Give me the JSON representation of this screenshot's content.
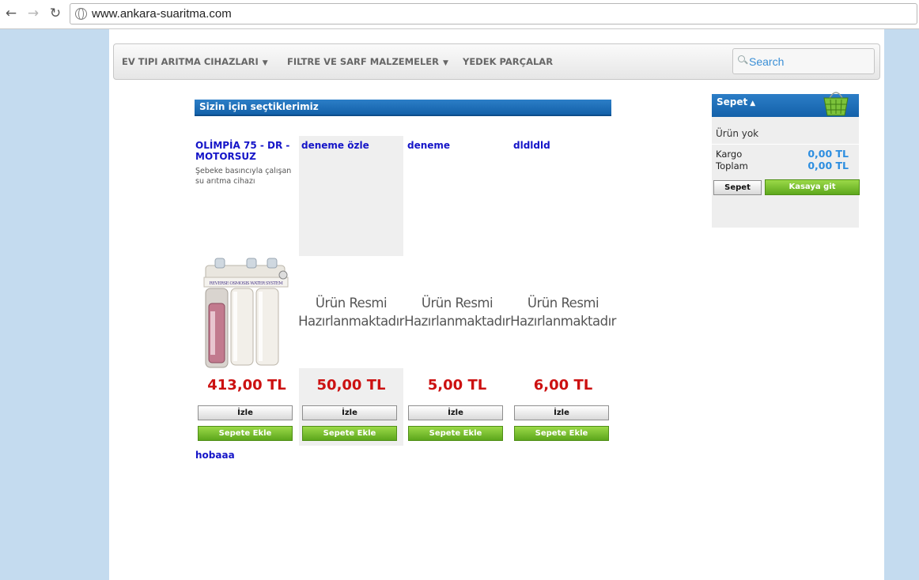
{
  "browser": {
    "url": "www.ankara-suaritma.com"
  },
  "menu": {
    "items": [
      {
        "label": "EV TIPI ARITMA CIHAZLARI",
        "has_dropdown": true
      },
      {
        "label": "FILTRE VE SARF MALZEMELER",
        "has_dropdown": true
      },
      {
        "label": "YEDEK PARÇALAR",
        "has_dropdown": false
      }
    ],
    "search_placeholder": "Search"
  },
  "section": {
    "title": "Sizin için seçtiklerimiz"
  },
  "products": [
    {
      "name": "OLİMPİA 75 - DR - MOTORSUZ",
      "description": "Şebeke basıncıyla çalışan su arıtma cihazı",
      "image": "filter-image",
      "price": "413,00 TL",
      "view_label": "İzle",
      "add_label": "Sepete Ekle"
    },
    {
      "name": "deneme özle",
      "description": "",
      "image": "placeholder",
      "image_text": "Ürün Resmi Hazırlanmaktadır",
      "price": "50,00 TL",
      "view_label": "İzle",
      "add_label": "Sepete Ekle"
    },
    {
      "name": "deneme",
      "description": "",
      "image": "placeholder",
      "image_text": "Ürün Resmi Hazırlanmaktadır",
      "price": "5,00 TL",
      "view_label": "İzle",
      "add_label": "Sepete Ekle"
    },
    {
      "name": "dldldld",
      "description": "",
      "image": "placeholder",
      "image_text": "Ürün Resmi Hazırlanmaktadır",
      "price": "6,00 TL",
      "view_label": "İzle",
      "add_label": "Sepete Ekle"
    }
  ],
  "extra_link": "hobaaa",
  "cart": {
    "title": "Sepet",
    "empty_text": "Ürün yok",
    "shipping_label": "Kargo",
    "shipping_value": "0,00 TL",
    "total_label": "Toplam",
    "total_value": "0,00 TL",
    "cart_button": "Sepet",
    "checkout_button": "Kasaya git"
  },
  "colors": {
    "header_blue": "#1361a9",
    "price_red": "#cc1111",
    "link_blue": "#1515c8",
    "button_green": "#5da71c",
    "amount_blue": "#2d8ee0"
  }
}
